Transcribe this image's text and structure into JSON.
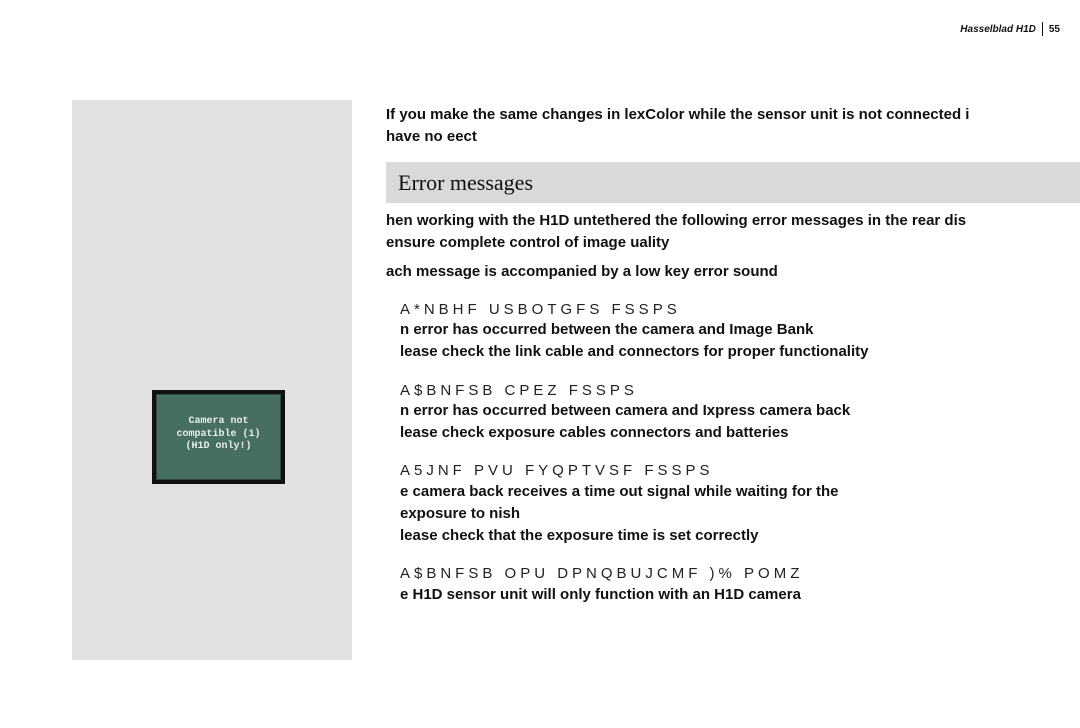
{
  "header": {
    "brand": "Hasselblad H1D",
    "page": "55"
  },
  "figure": {
    "lcd_line1": "Camera not",
    "lcd_line2": "compatible (1)",
    "lcd_line3": "(H1D only!)"
  },
  "intro_line1": "If you make the same changes in lexColor while the sensor unit is not connected i",
  "intro_line2": "have no eect",
  "section_heading": "Error messages",
  "body_line1": "hen working with the H1D untethered the following error messages in the rear dis",
  "body_line2": "ensure complete control of image uality",
  "body_line3": "ach message is accompanied by a low key error sound",
  "e1": {
    "title": "A*NBHF USBOTGFS FSSPS",
    "l1": "n error has occurred between the camera and Image Bank",
    "l2": "lease check the link cable and connectors for proper functionality"
  },
  "e2": {
    "title": "A$BNFSB CPEZ FSSPS",
    "l1": "n error has occurred between camera and Ixpress camera back",
    "l2": "lease check exposure cables connectors and batteries"
  },
  "e3": {
    "title": "A5JNF PVU FYQPTVSF FSSPS",
    "l1": "e camera back receives a time out signal while waiting for the",
    "l2": "exposure to nish",
    "l3": "lease check that the exposure time is set correctly"
  },
  "e4": {
    "title": "A$BNFSB OPU DPNQBUJCMF )% POMZ",
    "l1": "e H1D sensor unit will only function with an H1D camera"
  }
}
